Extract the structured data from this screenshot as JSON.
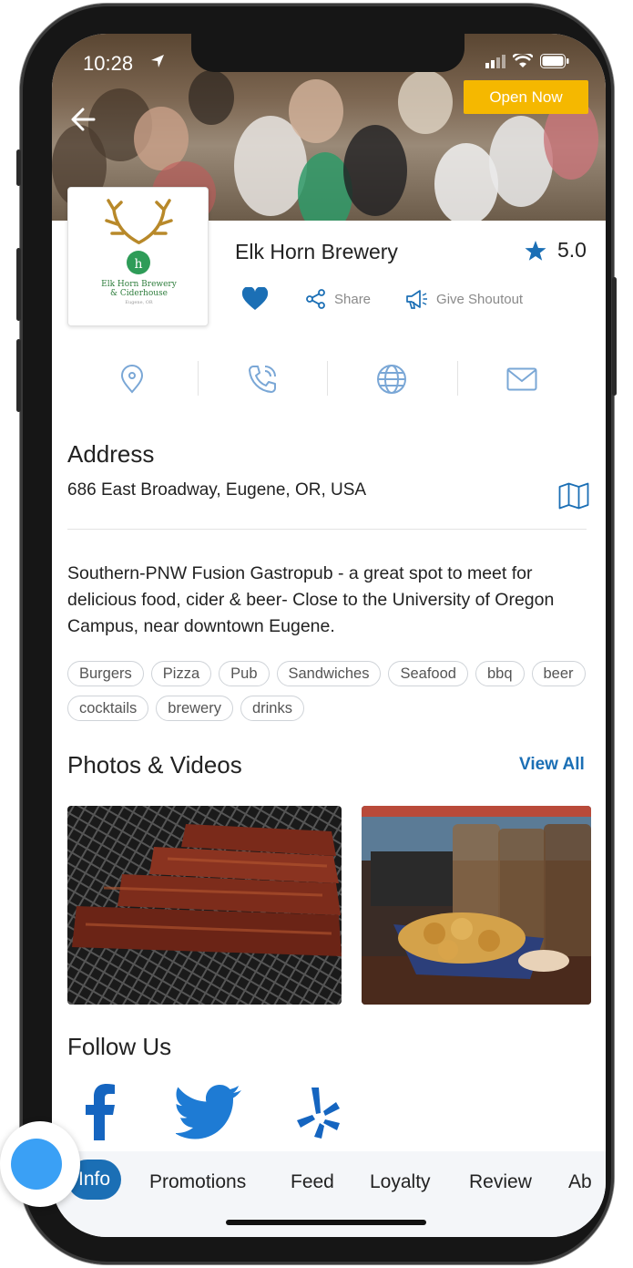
{
  "status_bar": {
    "time": "10:28"
  },
  "hero": {
    "open_badge": "Open Now"
  },
  "business": {
    "logo_text_line1": "Elk Horn Brewery",
    "logo_text_line2": "& Ciderhouse",
    "logo_text_line3": "Eugene, OR",
    "name": "Elk Horn Brewery",
    "rating": "5.0"
  },
  "actions": {
    "share_label": "Share",
    "shoutout_label": "Give Shoutout"
  },
  "address": {
    "title": "Address",
    "text": "686 East Broadway, Eugene, OR, USA"
  },
  "description": "Southern-PNW Fusion Gastropub - a great spot to meet for delicious food, cider & beer- Close to the University of Oregon Campus, near downtown Eugene.",
  "tags": [
    "Burgers",
    "Pizza",
    "Pub",
    "Sandwiches",
    "Seafood",
    "bbq",
    "beer",
    "cocktails",
    "brewery",
    "drinks"
  ],
  "photos": {
    "title": "Photos & Videos",
    "view_all": "View All"
  },
  "follow": {
    "title": "Follow Us"
  },
  "tabs": [
    {
      "label": "Info"
    },
    {
      "label": "Promotions"
    },
    {
      "label": "Feed"
    },
    {
      "label": "Loyalty"
    },
    {
      "label": "Review"
    },
    {
      "label": "Ab"
    }
  ],
  "colors": {
    "accent": "#1b6fb5",
    "badge": "#f5b800",
    "icon_light": "#7aa7d6",
    "facebook": "#1565c0",
    "twitter": "#1e7bd4",
    "yelp": "#1565c0"
  }
}
